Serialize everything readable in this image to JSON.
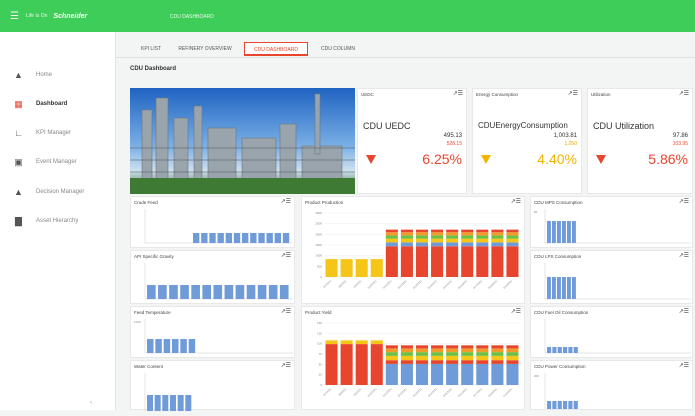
{
  "topbar": {
    "brand_text": "Life Is On",
    "logo": "Schneider",
    "app_title": "CDU DASHBOARD"
  },
  "sidebar": {
    "items": [
      {
        "label": "Home",
        "icon": "home-icon"
      },
      {
        "label": "Dashboard",
        "icon": "dashboard-icon"
      },
      {
        "label": "KPI Manager",
        "icon": "kpi-chart-icon"
      },
      {
        "label": "Event Manager",
        "icon": "event-icon"
      },
      {
        "label": "Decision Manager",
        "icon": "decision-icon"
      },
      {
        "label": "Asset Hierarchy",
        "icon": "hierarchy-icon"
      }
    ],
    "active": "Dashboard"
  },
  "tabs": [
    "KPI LIST",
    "REFINERY OVERVIEW",
    "CDU DASHBOARD",
    "CDU COLUMN"
  ],
  "active_tab": "CDU DASHBOARD",
  "page_title": "CDU Dashboard",
  "kpis": [
    {
      "card_title": "UEDC",
      "name": "CDU UEDC",
      "value": "495.13",
      "target": "528.15",
      "target_color": "red",
      "percent": "6.25%",
      "trend_color": "red"
    },
    {
      "card_title": "Energy Consumption",
      "name": "CDUEnergyConsumption",
      "value": "1,003.81",
      "target": "1,050",
      "target_color": "orange",
      "percent": "4.40%",
      "trend_color": "yellow"
    },
    {
      "card_title": "Utilization",
      "name": "CDU Utilization",
      "value": "97.86",
      "target": "103.95",
      "target_color": "red",
      "percent": "5.86%",
      "trend_color": "red"
    }
  ],
  "small_charts": {
    "crude_feed": {
      "title": "Crude Feed"
    },
    "api_gravity": {
      "title": "API Specific Gravity"
    },
    "feed_temperature": {
      "title": "Feed Temperature",
      "y_top": "1000"
    },
    "water_content": {
      "title": "Water Content"
    },
    "mps_consumption": {
      "title": "CDU MPS Consumption",
      "y_top": "50"
    },
    "lps_consumption": {
      "title": "CDU LPS Consumption"
    },
    "fuel_oil": {
      "title": "CDU Fuel Oil Consumption"
    },
    "power_consumption": {
      "title": "CDU Power Consumption",
      "y_top": "200"
    }
  },
  "product_production": {
    "title": "Product Production",
    "y_ticks": [
      "3000",
      "2500",
      "2000",
      "1500",
      "1000",
      "500",
      "0"
    ],
    "x_labels": [
      "5/7/2021",
      "5/8/2021",
      "5/9/2021",
      "5/10/2021",
      "5/11/2021",
      "5/12/2021",
      "5/13/2021",
      "5/14/2021",
      "5/15/2021",
      "5/16/2021",
      "5/17/2021",
      "5/18/2021",
      "5/19/2021"
    ]
  },
  "product_yield": {
    "title": "Product Yield",
    "y_ticks": [
      "150",
      "125",
      "100",
      "75",
      "50",
      "25",
      "0"
    ],
    "x_labels": [
      "5/7/2021",
      "5/8/2021",
      "5/9/2021",
      "5/10/2021",
      "5/11/2021",
      "5/12/2021",
      "5/13/2021",
      "5/14/2021",
      "5/15/2021",
      "5/16/2021",
      "5/17/2021",
      "5/18/2021",
      "5/19/2021"
    ]
  },
  "colors": {
    "green": "#3dcd58",
    "red": "#e8452f",
    "orange": "#f29a2e",
    "yellow": "#f5c518",
    "blue": "#6f9bd8",
    "bright_green": "#6dc046"
  }
}
